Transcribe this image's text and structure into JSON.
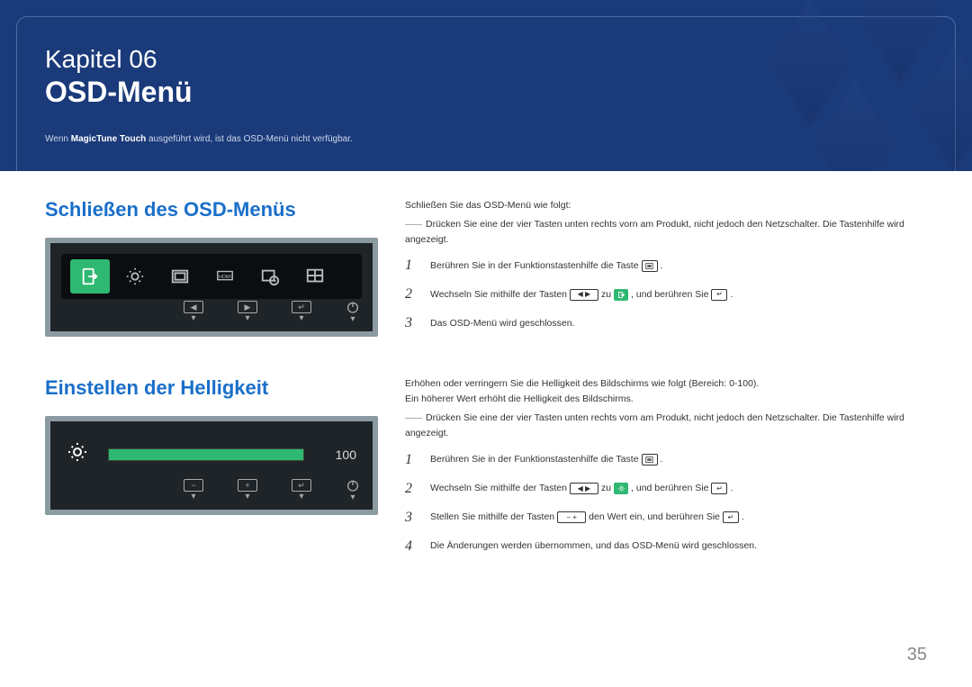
{
  "header": {
    "chapter": "Kapitel 06",
    "title": "OSD-Menü",
    "subnote_prefix": "Wenn ",
    "subnote_bold": "MagicTune Touch",
    "subnote_suffix": " ausgeführt wird, ist das OSD-Menü nicht verfügbar."
  },
  "section1": {
    "title": "Schließen des OSD-Menüs",
    "intro": "Schließen Sie das OSD-Menü wie folgt:",
    "dash": "Drücken Sie eine der vier Tasten unten rechts vorn am Produkt, nicht jedoch den Netzschalter. Die Tastenhilfe wird angezeigt.",
    "steps": [
      {
        "num": "1",
        "parts": [
          "Berühren Sie in der Funktionstastenhilfe die Taste ",
          {
            "icon": "menu"
          },
          "."
        ]
      },
      {
        "num": "2",
        "parts": [
          "Wechseln Sie mithilfe der Tasten ",
          {
            "icon": "leftright"
          },
          " zu ",
          {
            "icon": "exit-green"
          },
          ", und berühren Sie ",
          {
            "icon": "enter"
          },
          "."
        ]
      },
      {
        "num": "3",
        "parts": [
          "Das OSD-Menü wird geschlossen."
        ]
      }
    ]
  },
  "section2": {
    "title": "Einstellen der Helligkeit",
    "intro1": "Erhöhen oder verringern Sie die Helligkeit des Bildschirms wie folgt (Bereich: 0-100).",
    "intro2": "Ein höherer Wert erhöht die Helligkeit des Bildschirms.",
    "dash": "Drücken Sie eine der vier Tasten unten rechts vorn am Produkt, nicht jedoch den Netzschalter. Die Tastenhilfe wird angezeigt.",
    "slider_value": "100",
    "steps": [
      {
        "num": "1",
        "parts": [
          "Berühren Sie in der Funktionstastenhilfe die Taste ",
          {
            "icon": "menu"
          },
          "."
        ]
      },
      {
        "num": "2",
        "parts": [
          "Wechseln Sie mithilfe der Tasten ",
          {
            "icon": "leftright"
          },
          " zu ",
          {
            "icon": "bright-green"
          },
          ", und berühren Sie ",
          {
            "icon": "enter"
          },
          "."
        ]
      },
      {
        "num": "3",
        "parts": [
          "Stellen Sie mithilfe der Tasten ",
          {
            "icon": "minusplus"
          },
          " den Wert ein, und berühren Sie ",
          {
            "icon": "enter"
          },
          "."
        ]
      },
      {
        "num": "4",
        "parts": [
          "Die Änderungen werden übernommen, und das OSD-Menü wird geschlossen."
        ]
      }
    ]
  },
  "page_number": "35"
}
